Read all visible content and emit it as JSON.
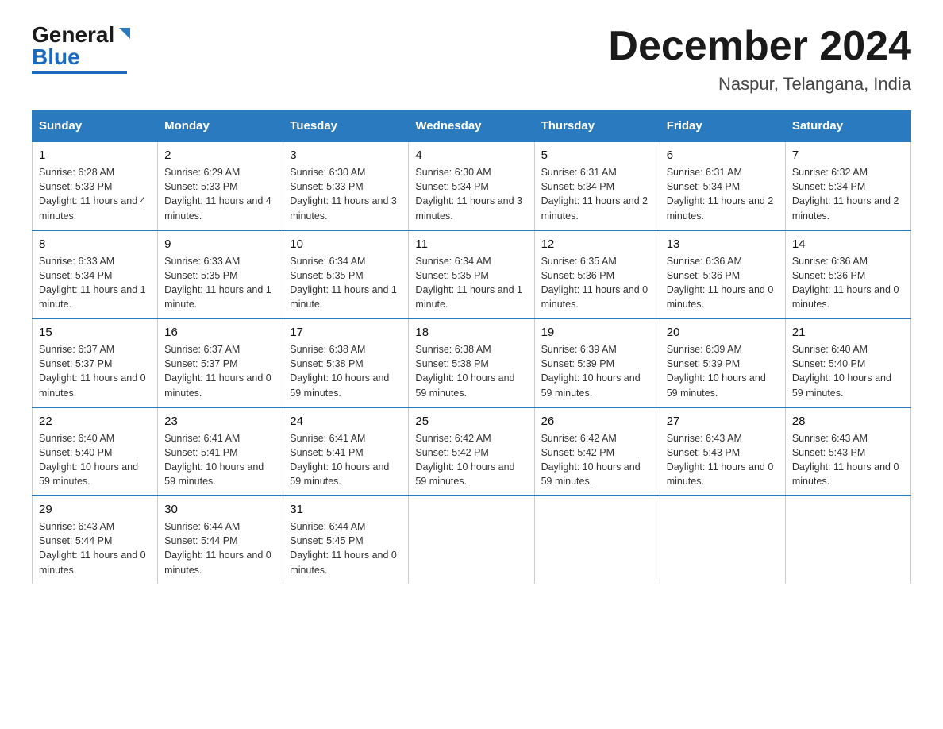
{
  "header": {
    "logo_general": "General",
    "logo_blue": "Blue",
    "main_title": "December 2024",
    "subtitle": "Naspur, Telangana, India"
  },
  "days_of_week": [
    "Sunday",
    "Monday",
    "Tuesday",
    "Wednesday",
    "Thursday",
    "Friday",
    "Saturday"
  ],
  "weeks": [
    [
      {
        "day": "1",
        "sunrise": "6:28 AM",
        "sunset": "5:33 PM",
        "daylight": "11 hours and 4 minutes."
      },
      {
        "day": "2",
        "sunrise": "6:29 AM",
        "sunset": "5:33 PM",
        "daylight": "11 hours and 4 minutes."
      },
      {
        "day": "3",
        "sunrise": "6:30 AM",
        "sunset": "5:33 PM",
        "daylight": "11 hours and 3 minutes."
      },
      {
        "day": "4",
        "sunrise": "6:30 AM",
        "sunset": "5:34 PM",
        "daylight": "11 hours and 3 minutes."
      },
      {
        "day": "5",
        "sunrise": "6:31 AM",
        "sunset": "5:34 PM",
        "daylight": "11 hours and 2 minutes."
      },
      {
        "day": "6",
        "sunrise": "6:31 AM",
        "sunset": "5:34 PM",
        "daylight": "11 hours and 2 minutes."
      },
      {
        "day": "7",
        "sunrise": "6:32 AM",
        "sunset": "5:34 PM",
        "daylight": "11 hours and 2 minutes."
      }
    ],
    [
      {
        "day": "8",
        "sunrise": "6:33 AM",
        "sunset": "5:34 PM",
        "daylight": "11 hours and 1 minute."
      },
      {
        "day": "9",
        "sunrise": "6:33 AM",
        "sunset": "5:35 PM",
        "daylight": "11 hours and 1 minute."
      },
      {
        "day": "10",
        "sunrise": "6:34 AM",
        "sunset": "5:35 PM",
        "daylight": "11 hours and 1 minute."
      },
      {
        "day": "11",
        "sunrise": "6:34 AM",
        "sunset": "5:35 PM",
        "daylight": "11 hours and 1 minute."
      },
      {
        "day": "12",
        "sunrise": "6:35 AM",
        "sunset": "5:36 PM",
        "daylight": "11 hours and 0 minutes."
      },
      {
        "day": "13",
        "sunrise": "6:36 AM",
        "sunset": "5:36 PM",
        "daylight": "11 hours and 0 minutes."
      },
      {
        "day": "14",
        "sunrise": "6:36 AM",
        "sunset": "5:36 PM",
        "daylight": "11 hours and 0 minutes."
      }
    ],
    [
      {
        "day": "15",
        "sunrise": "6:37 AM",
        "sunset": "5:37 PM",
        "daylight": "11 hours and 0 minutes."
      },
      {
        "day": "16",
        "sunrise": "6:37 AM",
        "sunset": "5:37 PM",
        "daylight": "11 hours and 0 minutes."
      },
      {
        "day": "17",
        "sunrise": "6:38 AM",
        "sunset": "5:38 PM",
        "daylight": "10 hours and 59 minutes."
      },
      {
        "day": "18",
        "sunrise": "6:38 AM",
        "sunset": "5:38 PM",
        "daylight": "10 hours and 59 minutes."
      },
      {
        "day": "19",
        "sunrise": "6:39 AM",
        "sunset": "5:39 PM",
        "daylight": "10 hours and 59 minutes."
      },
      {
        "day": "20",
        "sunrise": "6:39 AM",
        "sunset": "5:39 PM",
        "daylight": "10 hours and 59 minutes."
      },
      {
        "day": "21",
        "sunrise": "6:40 AM",
        "sunset": "5:40 PM",
        "daylight": "10 hours and 59 minutes."
      }
    ],
    [
      {
        "day": "22",
        "sunrise": "6:40 AM",
        "sunset": "5:40 PM",
        "daylight": "10 hours and 59 minutes."
      },
      {
        "day": "23",
        "sunrise": "6:41 AM",
        "sunset": "5:41 PM",
        "daylight": "10 hours and 59 minutes."
      },
      {
        "day": "24",
        "sunrise": "6:41 AM",
        "sunset": "5:41 PM",
        "daylight": "10 hours and 59 minutes."
      },
      {
        "day": "25",
        "sunrise": "6:42 AM",
        "sunset": "5:42 PM",
        "daylight": "10 hours and 59 minutes."
      },
      {
        "day": "26",
        "sunrise": "6:42 AM",
        "sunset": "5:42 PM",
        "daylight": "10 hours and 59 minutes."
      },
      {
        "day": "27",
        "sunrise": "6:43 AM",
        "sunset": "5:43 PM",
        "daylight": "11 hours and 0 minutes."
      },
      {
        "day": "28",
        "sunrise": "6:43 AM",
        "sunset": "5:43 PM",
        "daylight": "11 hours and 0 minutes."
      }
    ],
    [
      {
        "day": "29",
        "sunrise": "6:43 AM",
        "sunset": "5:44 PM",
        "daylight": "11 hours and 0 minutes."
      },
      {
        "day": "30",
        "sunrise": "6:44 AM",
        "sunset": "5:44 PM",
        "daylight": "11 hours and 0 minutes."
      },
      {
        "day": "31",
        "sunrise": "6:44 AM",
        "sunset": "5:45 PM",
        "daylight": "11 hours and 0 minutes."
      },
      null,
      null,
      null,
      null
    ]
  ],
  "labels": {
    "sunrise": "Sunrise:",
    "sunset": "Sunset:",
    "daylight": "Daylight:"
  }
}
